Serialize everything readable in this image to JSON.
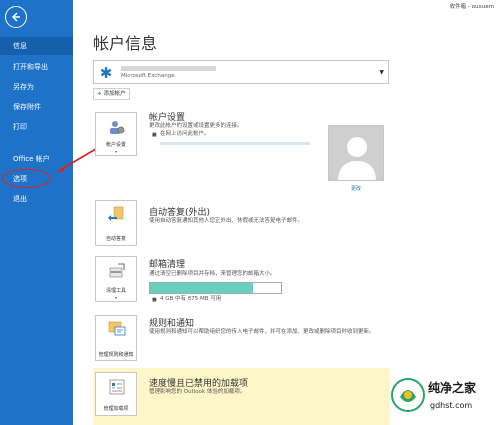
{
  "topbar": {
    "user": "收件箱 - ouxuem"
  },
  "sidebar": {
    "items": [
      {
        "label": "信息"
      },
      {
        "label": "打开和导出"
      },
      {
        "label": "另存为"
      },
      {
        "label": "保存附件"
      },
      {
        "label": "打印"
      },
      {
        "label": "Office 帐户"
      },
      {
        "label": "选项"
      },
      {
        "label": "退出"
      }
    ]
  },
  "main": {
    "title": "帐户信息",
    "account_type": "Microsoft Exchange",
    "add_account": "添加帐户",
    "account_settings": {
      "tile_label": "帐户设置",
      "title": "帐户设置",
      "desc": "更改此帐户的设置或设置更多的连接。",
      "bullet": "在网上访问此帐户。"
    },
    "profile": {
      "change": "更改"
    },
    "auto_reply": {
      "tile_label": "自动答复",
      "title": "自动答复(外出)",
      "desc": "使用自动答复通知其他人您正外出、休假或无法答复电子邮件。"
    },
    "cleanup": {
      "tile_label": "清理工具",
      "title": "邮箱清理",
      "desc": "通过清空已删除项目并存档，来管理您的邮箱大小。",
      "storage": "4 GB 中有 875 MB 可用",
      "storage_used_fraction": 0.79
    },
    "rules": {
      "tile_label": "管理规则和通知",
      "title": "规则和通知",
      "desc": "使用规则和通知可以帮助组织您的传入电子邮件，并可在添加、更改或删除项目时收到更新。"
    },
    "addins": {
      "tile_label": "管理加载项",
      "title": "速度慢且已禁用的加载项",
      "desc": "管理影响您的 Outlook 体验的加载项。"
    }
  },
  "watermark": {
    "brand": "纯净之家",
    "domain": "gdhst.com"
  },
  "colors": {
    "sidebar": "#1e73c8",
    "accent_red": "#e02020",
    "progress": "#6ad0be",
    "highlight": "#fdf6c9"
  }
}
